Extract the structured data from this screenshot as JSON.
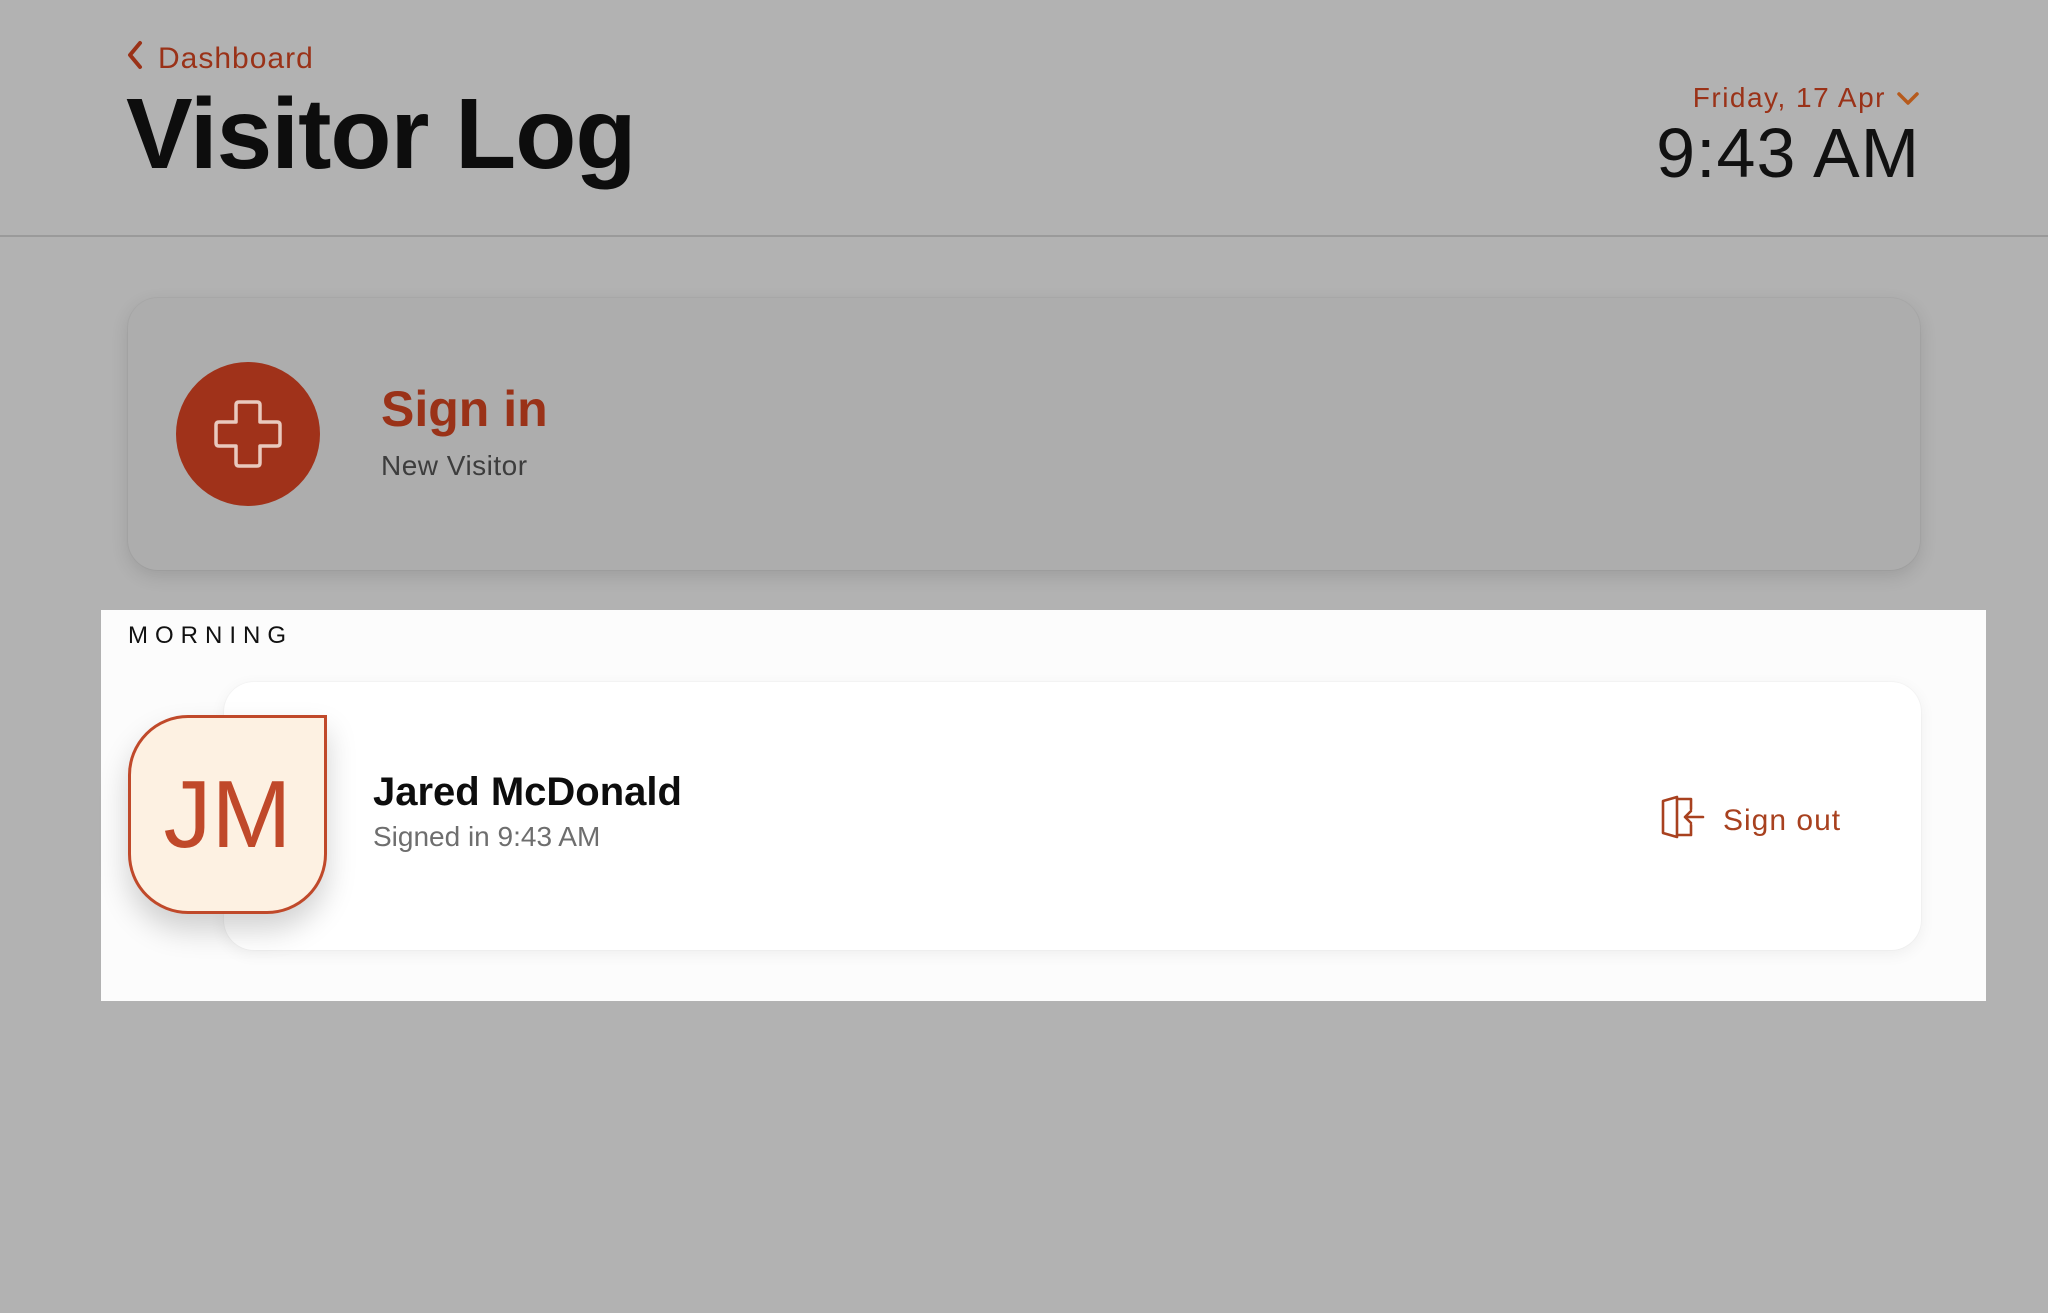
{
  "header": {
    "back_label": "Dashboard",
    "title": "Visitor Log",
    "date": "Friday, 17 Apr",
    "time": "9:43 AM"
  },
  "sign_in": {
    "title": "Sign in",
    "subtitle": "New Visitor"
  },
  "sections": [
    {
      "label": "MORNING",
      "visitors": [
        {
          "initials": "JM",
          "name": "Jared McDonald",
          "status": "Signed in 9:43 AM",
          "action_label": "Sign out"
        }
      ]
    }
  ],
  "colors": {
    "accent": "#9a3218",
    "avatar_bg": "#fdf1e2",
    "avatar_border": "#c0492a",
    "page_bg": "#b2b2b2",
    "section_bg": "#fcfcfc"
  },
  "icons": {
    "back": "chevron-left-icon",
    "date_dropdown": "chevron-down-icon",
    "sign_in": "plus-icon",
    "sign_out": "door-exit-icon"
  }
}
